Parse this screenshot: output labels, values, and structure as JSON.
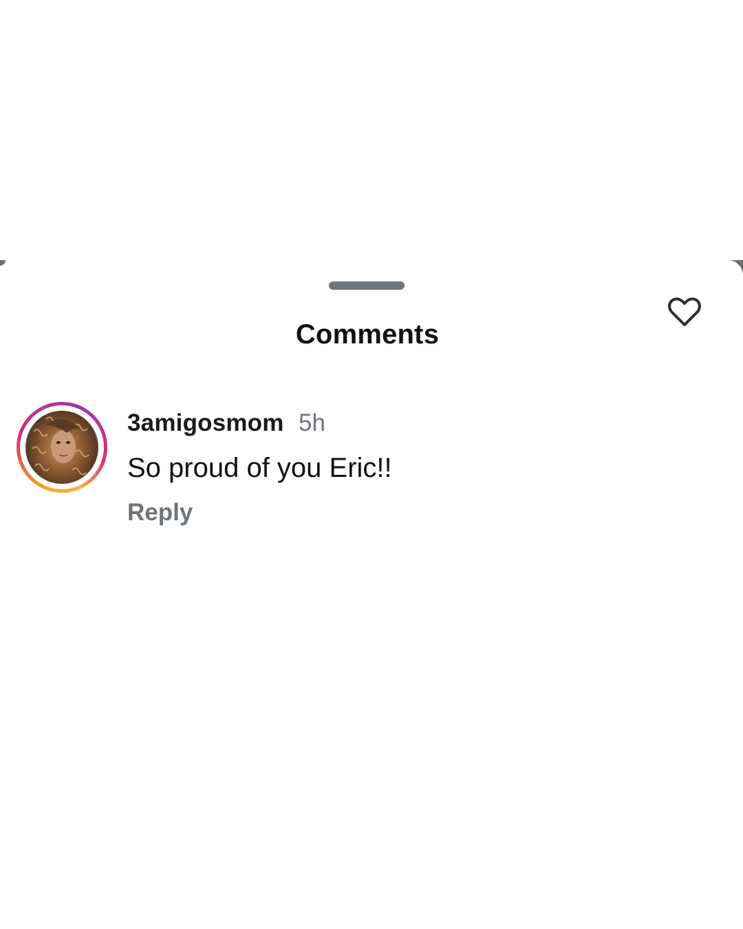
{
  "sheet": {
    "title": "Comments"
  },
  "comment": {
    "username": "3amigosmom",
    "time": "5h",
    "text": "So proud of you Eric!!",
    "reply_label": "Reply",
    "like_icon": "heart-outline-icon"
  },
  "colors": {
    "text_primary": "#111111",
    "text_secondary": "#6f747b",
    "handle": "#6f747b",
    "story_ring": [
      "#f5a623",
      "#e1306c",
      "#c13584"
    ]
  }
}
